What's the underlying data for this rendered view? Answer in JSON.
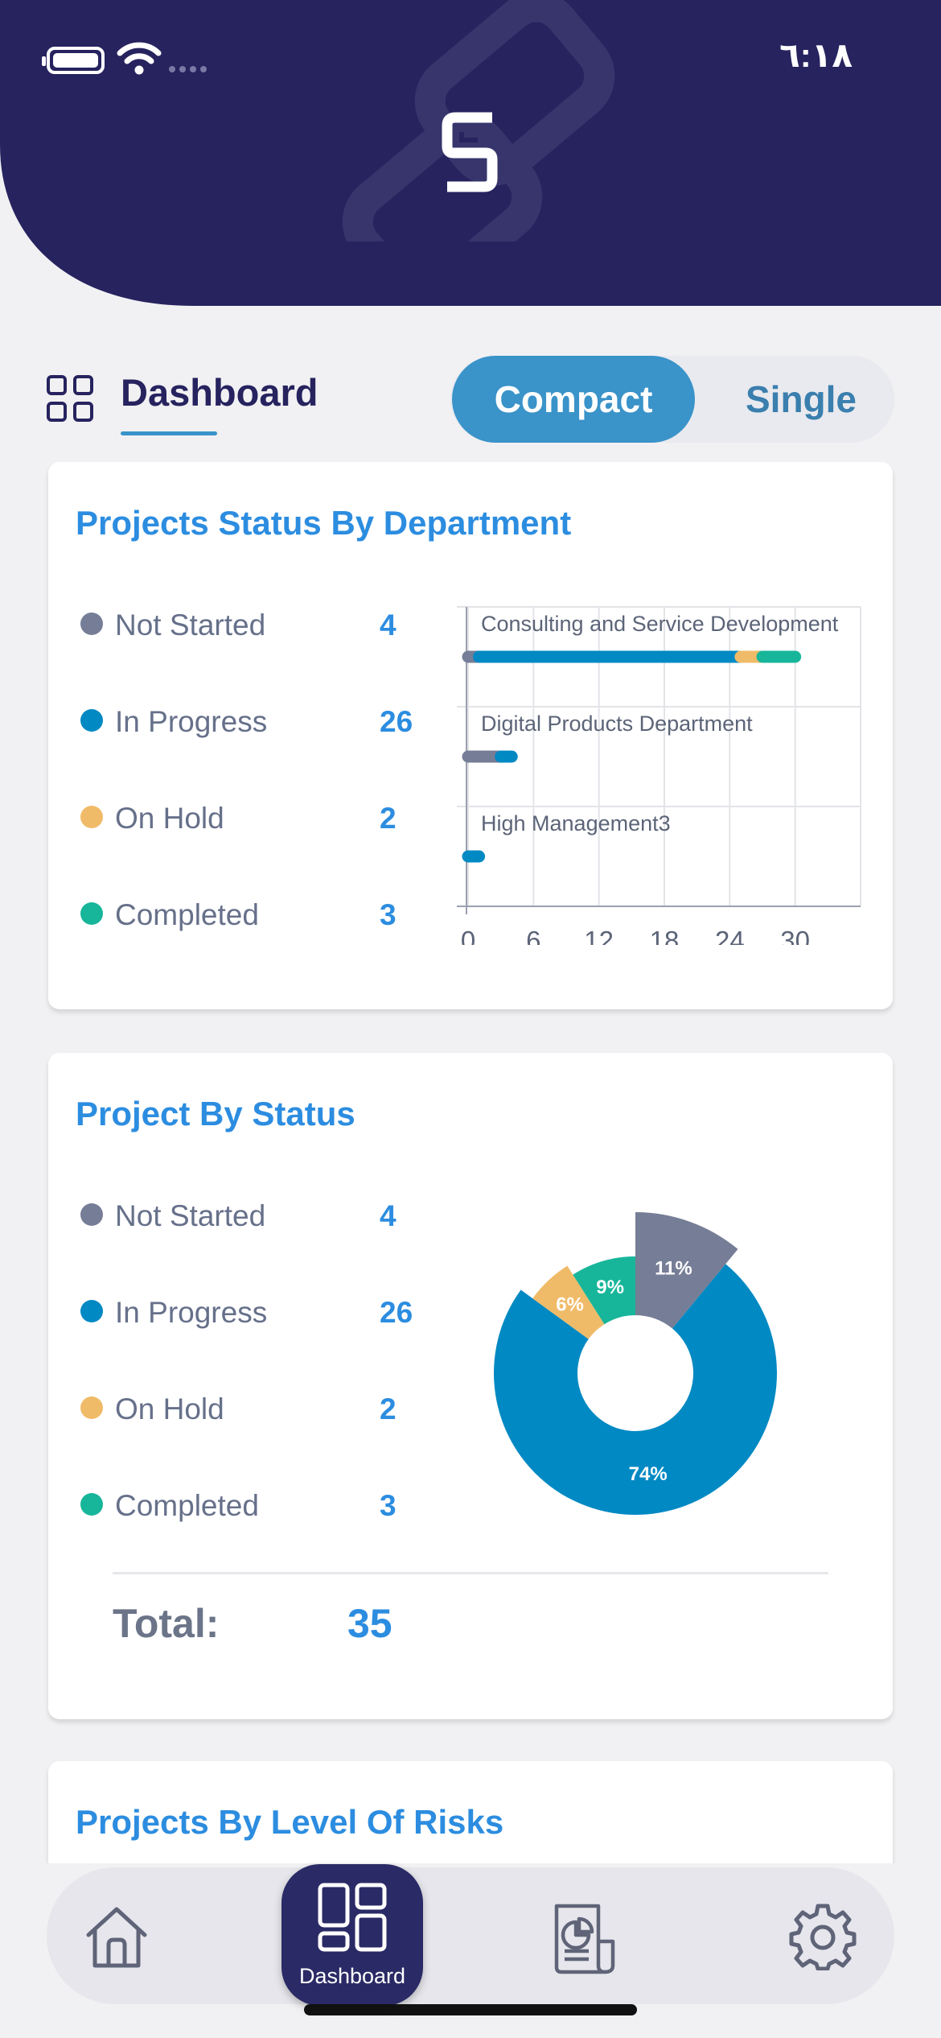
{
  "status_bar": {
    "time": "٦:١٨"
  },
  "header": {
    "title": "Dashboard",
    "view_toggle": {
      "compact": "Compact",
      "single": "Single",
      "selected": "Compact"
    }
  },
  "colors": {
    "not_started": "#767d96",
    "in_progress": "#0189c3",
    "on_hold": "#f0bb68",
    "completed": "#17b69a",
    "header": "#26235f",
    "accent": "#2c8de0"
  },
  "cards": [
    {
      "title": "Projects Status By Department",
      "legend": [
        {
          "label": "Not Started",
          "value": "4"
        },
        {
          "label": "In Progress",
          "value": "26"
        },
        {
          "label": "On Hold",
          "value": "2"
        },
        {
          "label": "Completed",
          "value": "3"
        }
      ]
    },
    {
      "title": "Project By Status",
      "legend": [
        {
          "label": "Not Started",
          "value": "4"
        },
        {
          "label": "In Progress",
          "value": "26"
        },
        {
          "label": "On Hold",
          "value": "2"
        },
        {
          "label": "Completed",
          "value": "3"
        }
      ],
      "total_label": "Total:",
      "total_value": "35"
    },
    {
      "title": "Projects By Level Of Risks"
    }
  ],
  "chart_data": [
    {
      "type": "bar",
      "orientation": "horizontal",
      "stacked": true,
      "categories": [
        "Consulting and Service Development",
        "Digital Products Department",
        "High Management3"
      ],
      "series": [
        {
          "name": "Not Started",
          "values": [
            1,
            3,
            0
          ]
        },
        {
          "name": "In Progress",
          "values": [
            24,
            1,
            1
          ]
        },
        {
          "name": "On Hold",
          "values": [
            2,
            0,
            0
          ]
        },
        {
          "name": "Completed",
          "values": [
            3,
            0,
            0
          ]
        }
      ],
      "x_ticks": [
        "0",
        "6",
        "12",
        "18",
        "24",
        "30"
      ],
      "xlim": [
        0,
        36
      ],
      "grid": true
    },
    {
      "type": "pie",
      "donut": true,
      "slices": [
        {
          "name": "Not Started",
          "value": 11,
          "label": "11%"
        },
        {
          "name": "In Progress",
          "value": 74,
          "label": "74%"
        },
        {
          "name": "On Hold",
          "value": 6,
          "label": "6%"
        },
        {
          "name": "Completed",
          "value": 9,
          "label": "9%"
        }
      ]
    }
  ],
  "bottom_nav": {
    "dashboard_label": "Dashboard"
  }
}
